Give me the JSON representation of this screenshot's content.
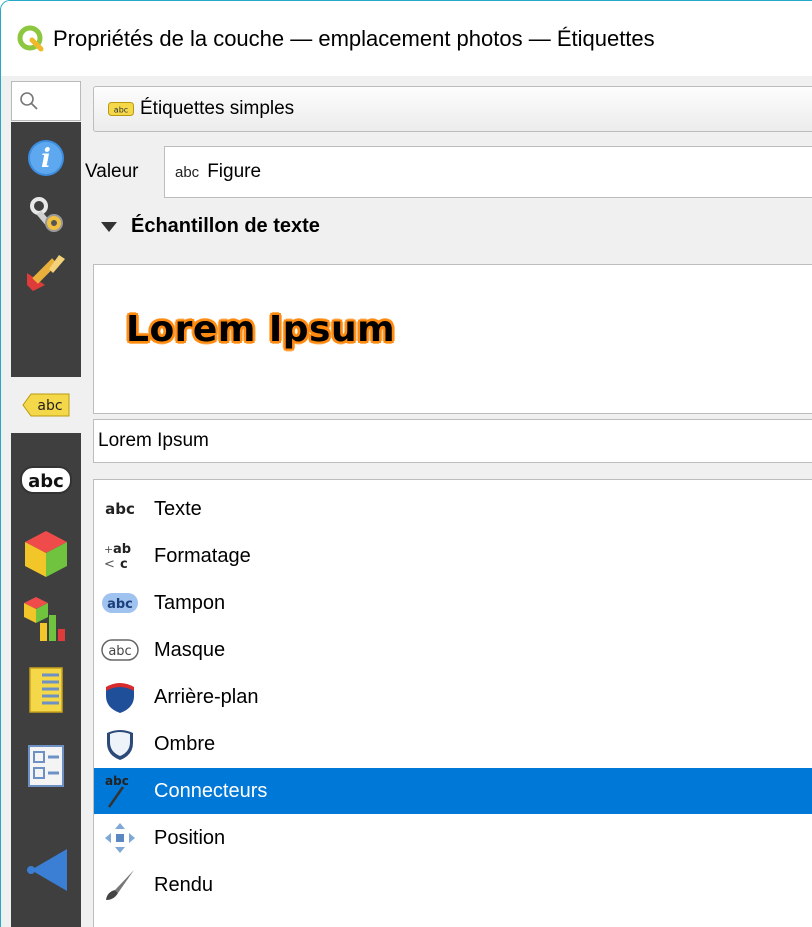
{
  "window": {
    "title": "Propriétés de la couche — emplacement photos — Étiquettes"
  },
  "colors": {
    "accent_border": "#27a8c9",
    "sidebar_bg": "#3f3f3f",
    "selection": "#0078d7",
    "preview_buffer": "#ff8a10"
  },
  "sidebar": {
    "search_icon": "search-icon",
    "items": [
      {
        "icon": "info-icon"
      },
      {
        "icon": "source-settings-icon"
      },
      {
        "icon": "symbology-brush-icon"
      },
      {
        "icon": "labels-icon",
        "text": "abc",
        "selected": true
      },
      {
        "icon": "masks-icon",
        "text": "abc"
      },
      {
        "icon": "3d-view-icon"
      },
      {
        "icon": "diagrams-icon"
      },
      {
        "icon": "fields-icon"
      },
      {
        "icon": "attributes-form-icon"
      },
      {
        "icon": "joins-icon"
      }
    ]
  },
  "labels_panel": {
    "mode_button": {
      "icon_text": "abc",
      "label": "Étiquettes simples"
    },
    "value": {
      "label": "Valeur",
      "prefix": "abc",
      "field": "Figure"
    },
    "section_title": "Échantillon de texte",
    "preview_text": "Lorem Ipsum",
    "sample_input": "Lorem Ipsum",
    "menu": [
      {
        "label": "Texte",
        "icon": "text-abc-icon",
        "icon_text": "abc"
      },
      {
        "label": "Formatage",
        "icon": "formatting-icon"
      },
      {
        "label": "Tampon",
        "icon": "buffer-icon",
        "icon_text": "abc"
      },
      {
        "label": "Masque",
        "icon": "mask-icon",
        "icon_text": "abc"
      },
      {
        "label": "Arrière-plan",
        "icon": "background-shield-icon"
      },
      {
        "label": "Ombre",
        "icon": "shadow-shield-icon"
      },
      {
        "label": "Connecteurs",
        "icon": "callouts-icon",
        "icon_text": "abc",
        "selected": true
      },
      {
        "label": "Position",
        "icon": "placement-arrows-icon"
      },
      {
        "label": "Rendu",
        "icon": "rendering-brush-icon"
      }
    ]
  }
}
